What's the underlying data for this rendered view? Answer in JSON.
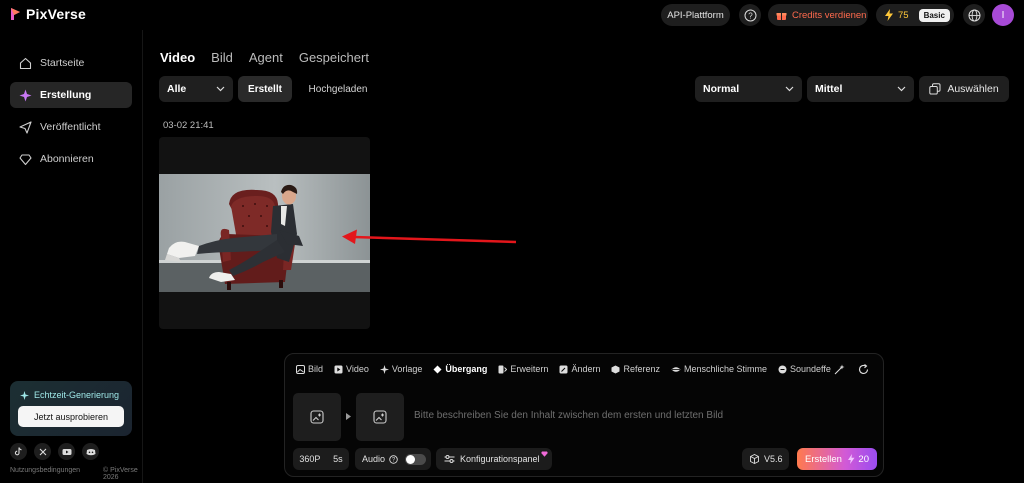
{
  "app": {
    "name": "PixVerse"
  },
  "topbar": {
    "api_label": "API-Plattform",
    "credits_label": "Credits verdienen",
    "credit_count": "75",
    "plan_badge": "Basic",
    "avatar_letter": "I"
  },
  "sidebar": {
    "items": [
      {
        "label": "Startseite",
        "icon": "home-icon"
      },
      {
        "label": "Erstellung",
        "icon": "sparkle-icon"
      },
      {
        "label": "Veröffentlicht",
        "icon": "send-icon"
      },
      {
        "label": "Abonnieren",
        "icon": "diamond-icon"
      }
    ],
    "active_index": 1,
    "promo_title": "Echtzeit-Generierung",
    "promo_button": "Jetzt ausprobieren",
    "footer_terms": "Nutzungsbedingungen",
    "footer_copyright": "© PixVerse 2026"
  },
  "main": {
    "tabs": [
      "Video",
      "Bild",
      "Agent",
      "Gespeichert"
    ],
    "active_tab": "Video",
    "filter_all": "Alle",
    "seg_created": "Erstellt",
    "seg_uploaded": "Hochgeladen",
    "quality": "Normal",
    "size": "Mittel",
    "select_label": "Auswählen",
    "date": "03-02 21:41"
  },
  "composer": {
    "tabs": [
      "Bild",
      "Video",
      "Vorlage",
      "Übergang",
      "Erweitern",
      "Ändern",
      "Referenz",
      "Menschliche Stimme",
      "Soundeffe"
    ],
    "active_tab": "Übergang",
    "prompt_placeholder": "Bitte beschreiben Sie den Inhalt zwischen dem ersten und letzten Bild",
    "resolution": "360P",
    "duration": "5s",
    "audio_label": "Audio",
    "config_label": "Konfigurationspanel",
    "model": "V5.6",
    "create_label": "Erstellen",
    "create_cost": "20"
  },
  "colors": {
    "accent_purple": "#a74ad6",
    "credits_orange": "#ff6a4d",
    "promo_teal": "#9fe8e8",
    "arrow_red": "#e3161b"
  }
}
